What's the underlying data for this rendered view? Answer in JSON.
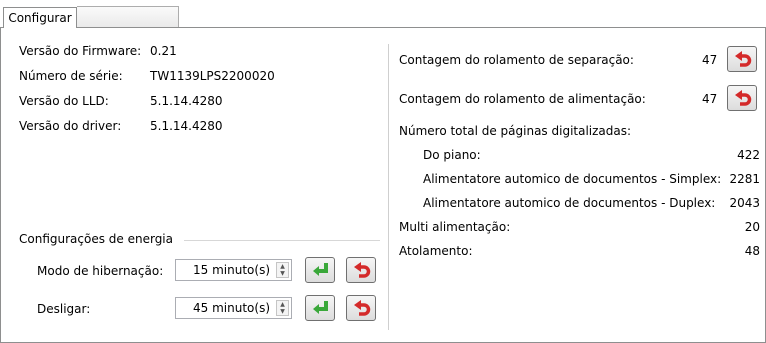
{
  "tab": {
    "label": "Configurar"
  },
  "info": [
    {
      "label": "Versão do Firmware:",
      "value": "0.21"
    },
    {
      "label": "Número de série:",
      "value": "TW1139LPS2200020"
    },
    {
      "label": "Versão do LLD:",
      "value": "5.1.14.4280"
    },
    {
      "label": "Versão do driver:",
      "value": "5.1.14.4280"
    }
  ],
  "energy": {
    "title": "Configurações de energia",
    "hibernate": {
      "label": "Modo de hibernação:",
      "value": "15 minuto(s)"
    },
    "shutdown": {
      "label": "Desligar:",
      "value": "45 minuto(s)"
    }
  },
  "counters": {
    "separation": {
      "label": "Contagem do rolamento de separação:",
      "value": "47"
    },
    "feed": {
      "label": "Contagem do rolamento de alimentação:",
      "value": "47"
    },
    "total_title": "Número total de páginas digitalizadas:",
    "pages": [
      {
        "label": "Do piano:",
        "value": "422"
      },
      {
        "label": "Alimentatore automico de documentos - Simplex:",
        "value": "2281"
      },
      {
        "label": "Alimentatore automico de documentos - Duplex:",
        "value": "2043"
      }
    ],
    "multi": {
      "label": "Multi alimentação:",
      "value": "20"
    },
    "jam": {
      "label": "Atolamento:",
      "value": "48"
    }
  },
  "colors": {
    "reset_arrow": "#d42a2a",
    "apply_arrow": "#3aa83a"
  },
  "icons": {
    "apply": "enter-arrow-icon",
    "reset": "undo-arrow-icon"
  }
}
